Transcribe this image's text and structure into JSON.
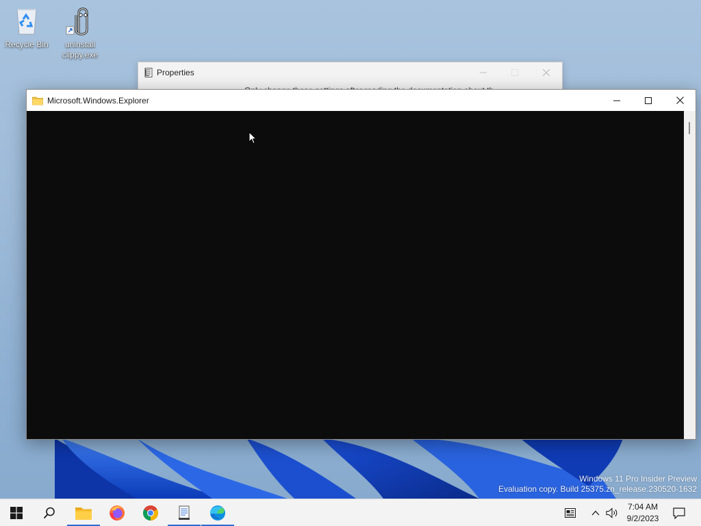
{
  "desktop": {
    "icons": [
      {
        "label": "Recycle Bin",
        "icon": "recycle-bin-icon"
      },
      {
        "label": "uninstall\nclippy.exe",
        "icon": "paperclip-icon"
      }
    ],
    "watermark": {
      "line1": "Windows 11 Pro Insider Preview",
      "line2": "Evaluation copy. Build 25375.zn_release.230520-1632"
    }
  },
  "properties_window": {
    "title": "Properties",
    "body_partial": "Only change these settings after reading the documentation about th",
    "controls": [
      "minimize",
      "maximize",
      "close"
    ]
  },
  "explorer_window": {
    "title": "Microsoft.Windows.Explorer",
    "icon": "folder-icon",
    "console_background": "#0c0c0c",
    "controls": [
      "minimize",
      "maximize",
      "close"
    ]
  },
  "taskbar": {
    "items": [
      {
        "name": "start",
        "icon": "windows-logo-icon"
      },
      {
        "name": "search",
        "icon": "search-icon"
      },
      {
        "name": "file-explorer",
        "icon": "folder-icon",
        "active": true
      },
      {
        "name": "firefox",
        "icon": "firefox-icon"
      },
      {
        "name": "chrome",
        "icon": "chrome-icon"
      },
      {
        "name": "notepad",
        "icon": "notepad-icon",
        "active": true
      },
      {
        "name": "edge",
        "icon": "edge-icon",
        "active": true
      }
    ],
    "tray": {
      "time": "7:04 AM",
      "date": "9/2/2023"
    }
  },
  "colors": {
    "accent": "#2b6ad1",
    "taskbar_bg": "#f3f3f3",
    "console_bg": "#0c0c0c"
  }
}
